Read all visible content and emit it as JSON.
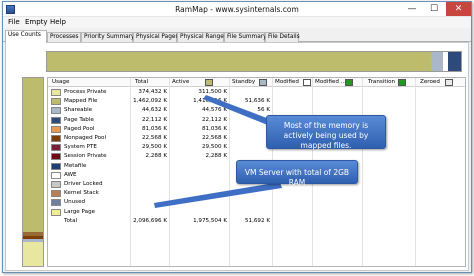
{
  "window": {
    "title": "RamMap - www.sysinternals.com"
  },
  "controls": {
    "minimize": "—",
    "maximize": "☐",
    "close": "✕"
  },
  "menu": [
    "File",
    "Empty",
    "Help"
  ],
  "tabs": [
    "Use Counts",
    "Processes",
    "Priority Summary",
    "Physical Pages",
    "Physical Ranges",
    "File Summary",
    "File Details"
  ],
  "active_tab": "Use Counts",
  "colors": {
    "frame": "#6a8fb5",
    "accent": "#2f5fb0",
    "olive": "#bdbb6c",
    "standby": "#aab7c8",
    "green": "#1f9a1f",
    "process_private": "#e8e7a0",
    "mapped_file": "#bdbb6c",
    "page_table": "#2e4a7a",
    "paged_pool": "#e89a55",
    "nonpaged_pool": "#7c3e08",
    "system_pte": "#7a1e35",
    "session_private": "#6f0a14",
    "metafile": "#1e3e72",
    "awe": "#ffffff",
    "driver_locked": "#c8c8c8",
    "kernel_stack": "#b47e58",
    "unused": "#6e7fa0",
    "large_page": "#f2ee93"
  },
  "columns": [
    "Usage",
    "Total",
    "Active",
    "Standby",
    "Modified",
    "Modified ...",
    "Transition",
    "Zeroed"
  ],
  "rows": [
    {
      "name": "Process Private",
      "total": "374,432 K",
      "active": "311,500 K",
      "standby": "",
      "color_key": "process_private"
    },
    {
      "name": "Mapped File",
      "total": "1,462,092 K",
      "active": "1,410,416 K",
      "standby": "51,636 K",
      "color_key": "mapped_file"
    },
    {
      "name": "Shareable",
      "total": "44,632 K",
      "active": "44,576 K",
      "standby": "56 K",
      "color_key": "standby"
    },
    {
      "name": "Page Table",
      "total": "22,112 K",
      "active": "22,112 K",
      "standby": "",
      "color_key": "page_table"
    },
    {
      "name": "Paged Pool",
      "total": "81,036 K",
      "active": "81,036 K",
      "standby": "",
      "color_key": "paged_pool"
    },
    {
      "name": "Nonpaged Pool",
      "total": "22,568 K",
      "active": "22,568 K",
      "standby": "",
      "color_key": "nonpaged_pool"
    },
    {
      "name": "System PTE",
      "total": "29,500 K",
      "active": "29,500 K",
      "standby": "",
      "color_key": "system_pte"
    },
    {
      "name": "Session Private",
      "total": "2,288 K",
      "active": "2,288 K",
      "standby": "",
      "color_key": "session_private"
    },
    {
      "name": "Metafile",
      "total": "",
      "active": "",
      "standby": "",
      "color_key": "metafile"
    },
    {
      "name": "AWE",
      "total": "",
      "active": "",
      "standby": "",
      "color_key": "awe"
    },
    {
      "name": "Driver Locked",
      "total": "",
      "active": "",
      "standby": "",
      "color_key": "driver_locked"
    },
    {
      "name": "Kernel Stack",
      "total": "",
      "active": "",
      "standby": "",
      "color_key": "kernel_stack"
    },
    {
      "name": "Unused",
      "total": "",
      "active": "",
      "standby": "",
      "color_key": "unused"
    },
    {
      "name": "Large Page",
      "total": "",
      "active": "",
      "standby": "",
      "color_key": "large_page"
    },
    {
      "name": "Total",
      "total": "2,096,696 K",
      "active": "1,975,504 K",
      "standby": "51,692 K",
      "color_key": ""
    }
  ],
  "callouts": {
    "mapped": "Most of the memory is actively being used by mapped files.",
    "vm": "VM Server with total of 2GB RAM"
  }
}
